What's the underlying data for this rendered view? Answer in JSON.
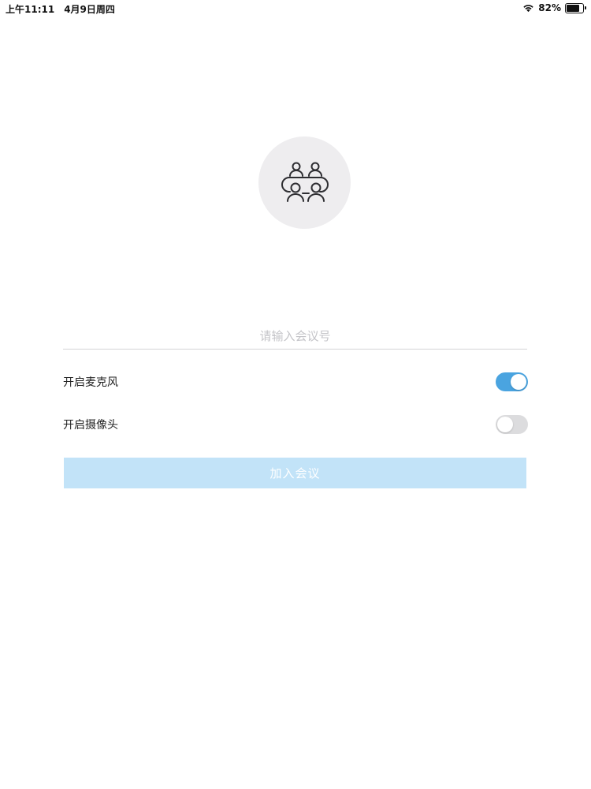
{
  "status_bar": {
    "time": "上午11:11",
    "date": "4月9日周四",
    "battery": "82%",
    "battery_level": 0.82
  },
  "avatar": {
    "icon": "meeting-table-icon"
  },
  "meeting_input": {
    "value": "",
    "placeholder": "请输入会议号"
  },
  "options": {
    "mic": {
      "label": "开启麦克风",
      "on": true
    },
    "camera": {
      "label": "开启摄像头",
      "on": false
    }
  },
  "join_button": {
    "label": "加入会议",
    "enabled": false
  },
  "colors": {
    "accent": "#4aa4e0",
    "button_disabled": "#c2e3f8",
    "toggle_off": "#dcdcde",
    "avatar_bg": "#eeedef"
  }
}
